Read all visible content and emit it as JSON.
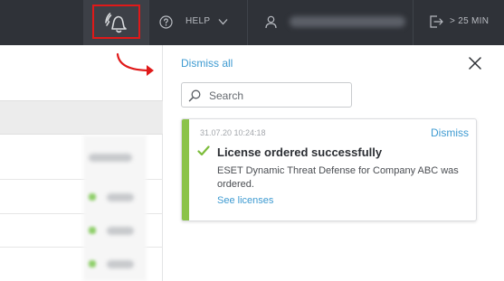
{
  "topbar": {
    "help_label": "HELP",
    "logout_label": "> 25 MIN",
    "icons": {
      "notifications": "bell-icon",
      "help": "question-circle-icon",
      "help_caret": "chevron-down-icon",
      "user": "user-icon",
      "logout": "logout-icon"
    }
  },
  "notifications_panel": {
    "dismiss_all_label": "Dismiss all",
    "close_icon": "close-icon",
    "search": {
      "placeholder": "Search",
      "value": "",
      "icon": "search-icon"
    },
    "items": [
      {
        "timestamp": "31.07.20 10:24:18",
        "dismiss_label": "Dismiss",
        "title": "License ordered successfully",
        "body": "ESET Dynamic Threat Defense for Company ABC was ordered.",
        "link_label": "See licenses",
        "status_icon": "checkmark-icon"
      }
    ]
  },
  "colors": {
    "topbar_bg": "#2f3238",
    "highlight_red": "#e01919",
    "link_blue": "#3d9ad1",
    "success_green": "#8bc34a"
  }
}
